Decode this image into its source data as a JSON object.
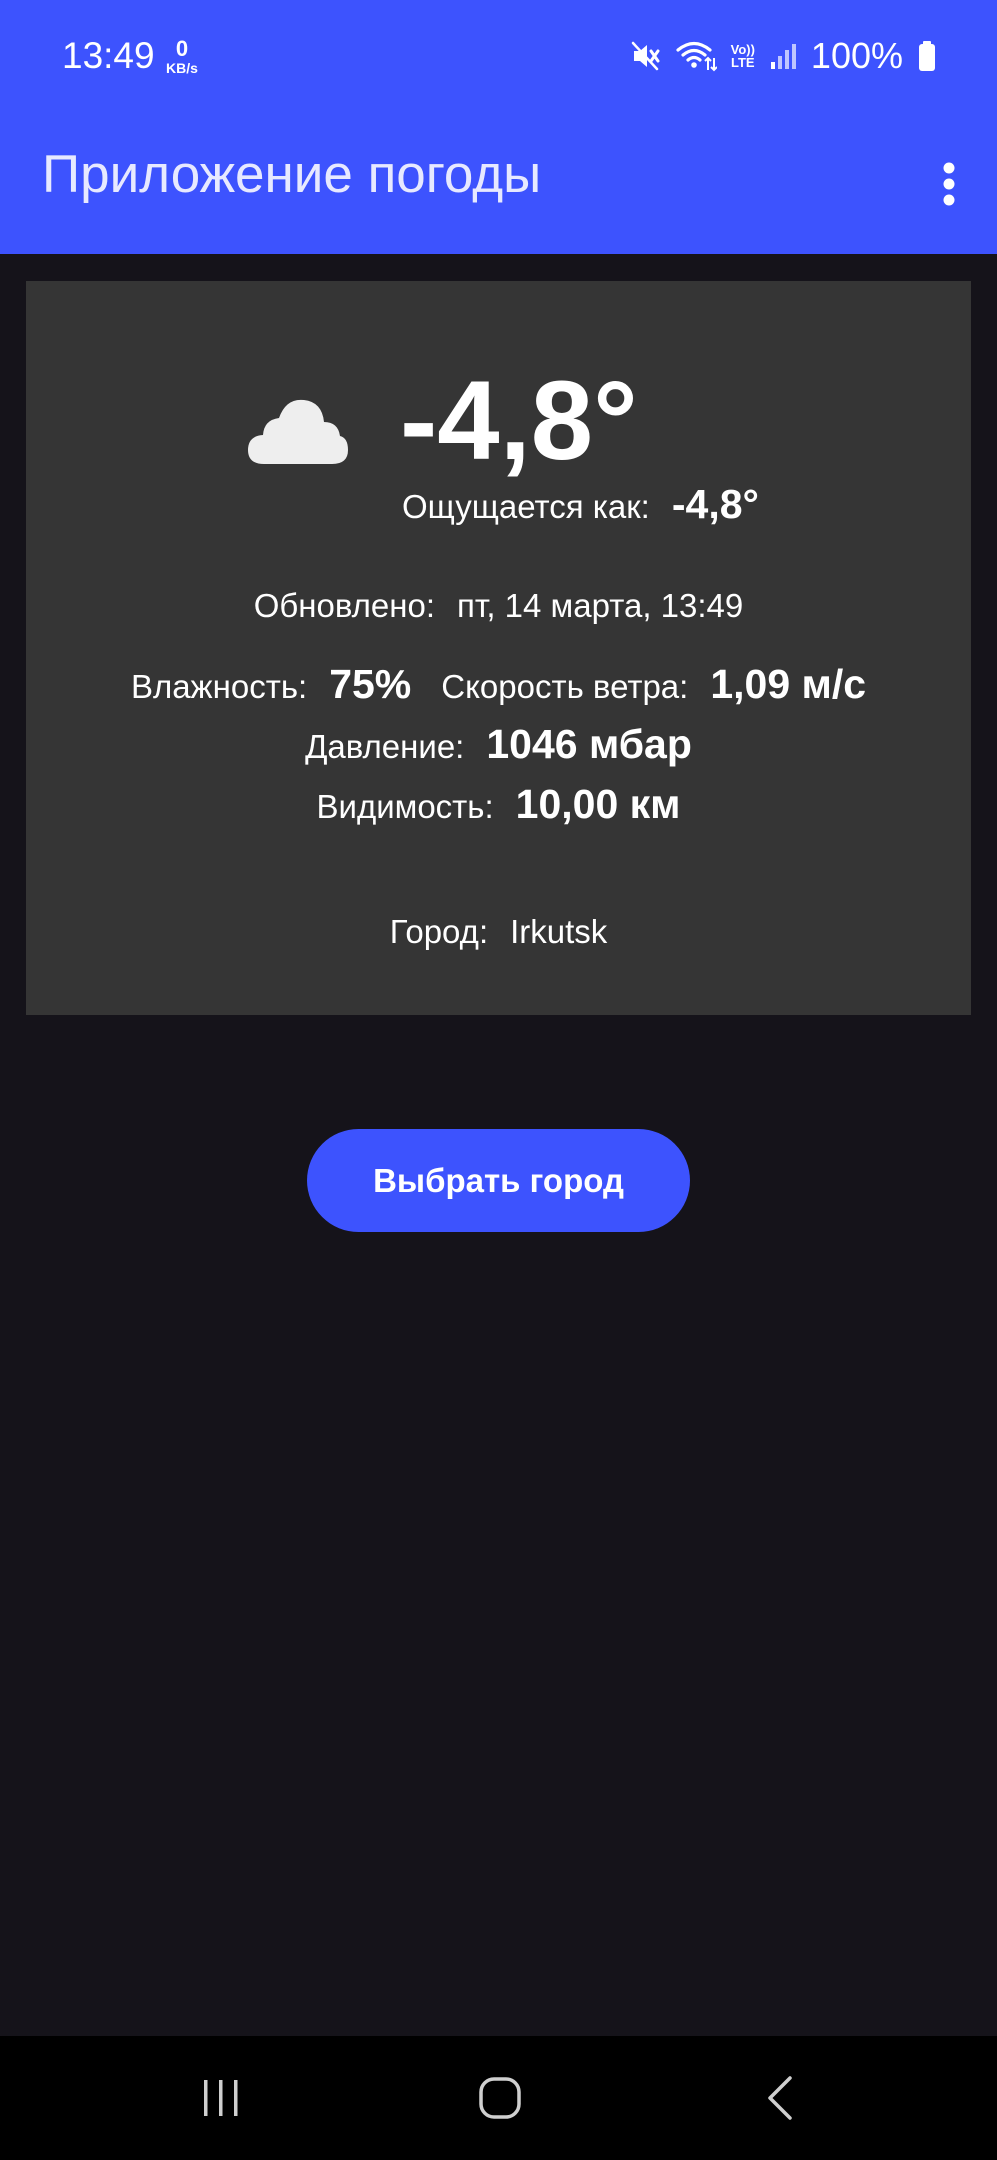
{
  "status_bar": {
    "time": "13:49",
    "net_speed_value": "0",
    "net_speed_unit": "KB/s",
    "volte_line1": "Vo))",
    "volte_line2": "LTE",
    "battery_percent": "100%",
    "icons": [
      "mute-icon",
      "wifi-icon",
      "volte-icon",
      "signal-icon",
      "battery-icon"
    ]
  },
  "app_bar": {
    "title": "Приложение погоды",
    "menu_icon": "more-vert-icon"
  },
  "weather": {
    "icon": "cloud-icon",
    "temperature": "-4,8°",
    "feels_like_label": "Ощущается как:",
    "feels_like_value": "-4,8°",
    "updated_label": "Обновлено:",
    "updated_value": "пт, 14 марта, 13:49",
    "humidity_label": "Влажность:",
    "humidity_value": "75%",
    "wind_label": "Скорость ветра:",
    "wind_value": "1,09 м/с",
    "pressure_label": "Давление:",
    "pressure_value": "1046 мбар",
    "visibility_label": "Видимость:",
    "visibility_value": "10,00 км",
    "city_label": "Город:",
    "city_value": "Irkutsk"
  },
  "actions": {
    "select_city_label": "Выбрать город"
  },
  "nav_bar": {
    "icons": [
      "recents-icon",
      "home-icon",
      "back-icon"
    ]
  },
  "colors": {
    "primary": "#3d53fe",
    "background": "#15131a",
    "card": "#353535",
    "cloud": "#eeeeee"
  }
}
